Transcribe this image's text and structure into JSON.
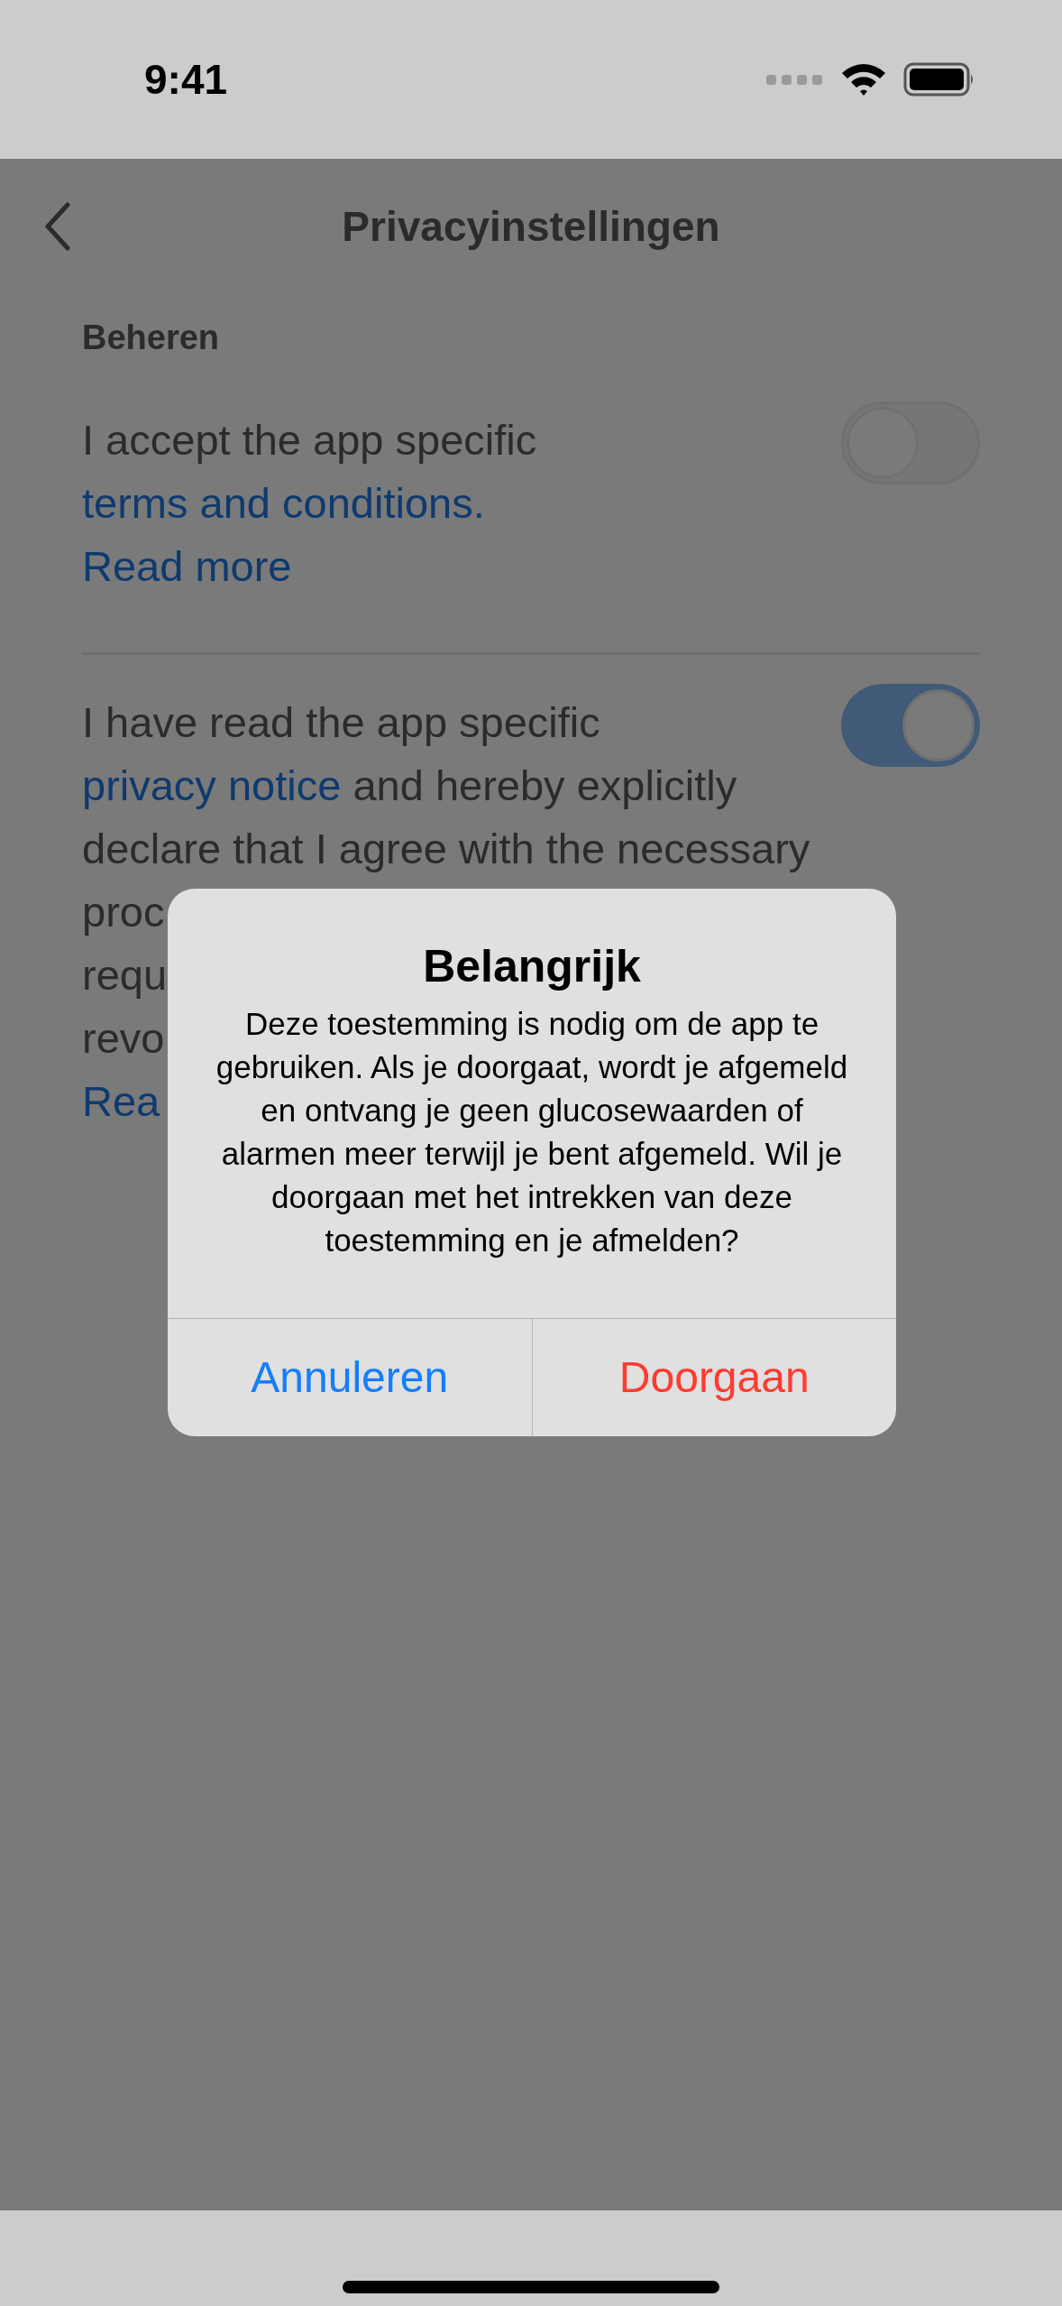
{
  "status_bar": {
    "time": "9:41"
  },
  "nav": {
    "title": "Privacyinstellingen"
  },
  "section": {
    "title": "Beheren"
  },
  "items": [
    {
      "parts": [
        {
          "text": "I accept the app specific ",
          "link": false
        },
        {
          "text": "terms and conditions.",
          "link": true
        }
      ],
      "read_more": "Read more",
      "on": false
    },
    {
      "parts": [
        {
          "text": "I have read the app specific ",
          "link": false
        },
        {
          "text": "privacy notice",
          "link": true
        },
        {
          "text": " and hereby explicitly declare that I agree with the necessary",
          "link": false
        }
      ],
      "covered_lines": [
        "proc",
        "requ",
        "revo"
      ],
      "read_more": "Rea",
      "on": true
    }
  ],
  "dialog": {
    "title": "Belangrijk",
    "message": "Deze toestemming is nodig om de app te gebruiken. Als je doorgaat, wordt je afgemeld en ontvang je geen glucosewaarden of alarmen meer terwijl je bent afgemeld. Wil je doorgaan met het intrekken van deze toestemming en je afmelden?",
    "buttons": [
      {
        "label": "Annuleren",
        "kind": "cancel"
      },
      {
        "label": "Doorgaan",
        "kind": "destructive"
      }
    ]
  }
}
